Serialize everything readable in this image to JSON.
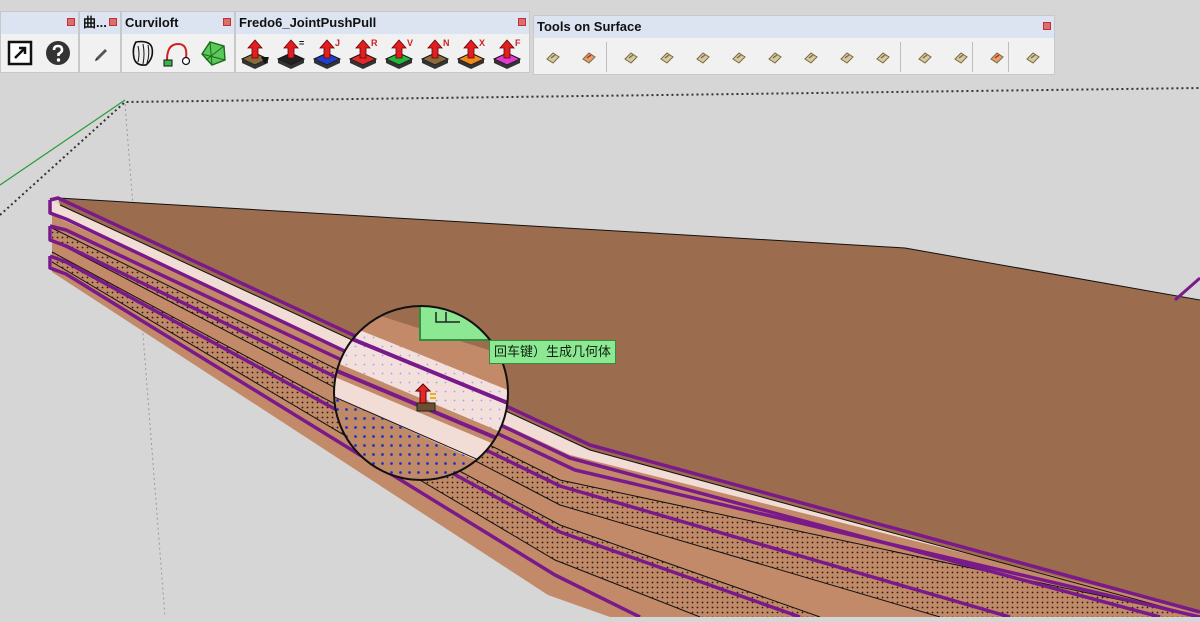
{
  "toolbars": {
    "left_partial": {
      "title": ""
    },
    "qu": {
      "title": "曲..."
    },
    "curviloft": {
      "title": "Curviloft"
    },
    "fredo": {
      "title": "Fredo6_JointPushPull",
      "letters": [
        "",
        "=",
        "J",
        "R",
        "V",
        "N",
        "X",
        "F"
      ],
      "top_colors": [
        "#8a6a3a",
        "#222222",
        "#1f3fd0",
        "#e02a2a",
        "#22b83a",
        "#8a6a3a",
        "#f08a1a",
        "#e03ad0"
      ]
    },
    "tools_on_surface": {
      "title": "Tools on Surface"
    }
  },
  "viewport": {
    "tooltip_text": "回车键）生成几何体",
    "colors": {
      "background": "#d6d6d6",
      "surface_top": "#9b6c4e",
      "band_pink": "#f2dcd6",
      "band_brown": "#c28a68",
      "edge_purple": "#7a1a8a",
      "axis_green": "#2a9a3a"
    }
  },
  "icons": {
    "maximize": "maximize-icon",
    "help": "help-icon",
    "pencil": "pencil-icon",
    "curviloft_loft": "loft-shape-icon",
    "curviloft_path": "curve-path-icon",
    "curviloft_skin": "skin-patch-icon"
  }
}
